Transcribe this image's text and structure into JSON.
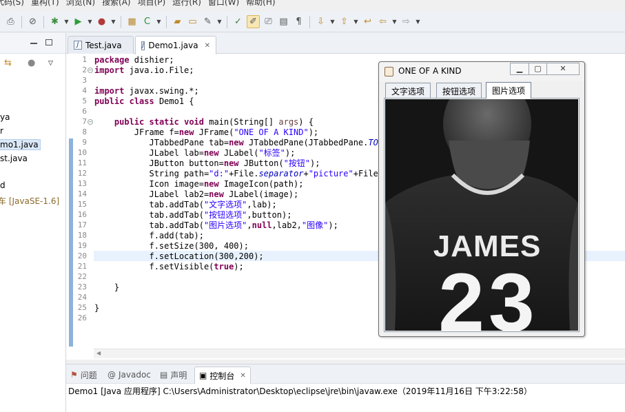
{
  "menubar": [
    "代码(S)",
    "重构(T)",
    "浏览(N)",
    "搜索(A)",
    "项目(P)",
    "运行(R)",
    "窗口(W)",
    "帮助(H)"
  ],
  "explorer": {
    "items": [
      "ya",
      "r",
      "mo1.java",
      "st.java",
      "d",
      "车 [JavaSE-1.6]"
    ]
  },
  "editor": {
    "tabs": [
      {
        "label": "Test.java"
      },
      {
        "label": "Demo1.java"
      }
    ],
    "line_numbers": [
      "1",
      "2",
      "3",
      "4",
      "5",
      "6",
      "7",
      "8",
      "9",
      "10",
      "11",
      "12",
      "13",
      "14",
      "15",
      "16",
      "17",
      "18",
      "19",
      "20",
      "21",
      "22",
      "23",
      "24",
      "25",
      "26"
    ]
  },
  "console": {
    "tabs": [
      "问题",
      "Javadoc",
      "声明",
      "控制台"
    ],
    "line": "Demo1 [Java 应用程序] C:\\Users\\Administrator\\Desktop\\eclipse\\jre\\bin\\javaw.exe（2019年11月16日 下午3:22:58）"
  },
  "swing": {
    "title": "ONE OF A KIND",
    "tabs": [
      "文字选项",
      "按钮选项",
      "图片选项"
    ],
    "jersey_name": "JAMES",
    "jersey_number": "23"
  },
  "colors": {
    "keyword": "#7f0055",
    "string": "#2a00ff",
    "field": "#0000c0",
    "current_line": "#e8f2fe",
    "change_bar": "#8db3d9"
  }
}
